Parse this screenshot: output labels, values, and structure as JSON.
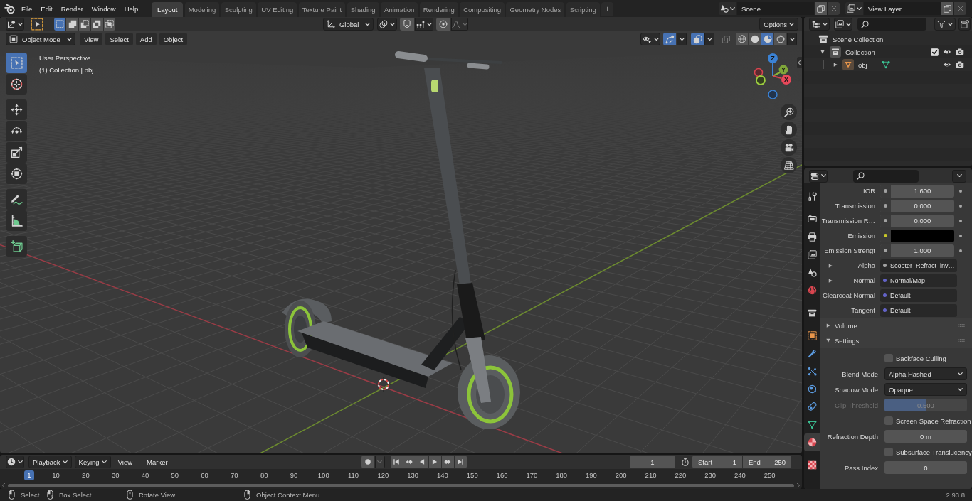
{
  "top_bar": {
    "menus": [
      "File",
      "Edit",
      "Render",
      "Window",
      "Help"
    ],
    "workspaces": [
      {
        "label": "Layout",
        "selected": true
      },
      {
        "label": "Modeling",
        "selected": false
      },
      {
        "label": "Sculpting",
        "selected": false
      },
      {
        "label": "UV Editing",
        "selected": false
      },
      {
        "label": "Texture Paint",
        "selected": false
      },
      {
        "label": "Shading",
        "selected": false
      },
      {
        "label": "Animation",
        "selected": false
      },
      {
        "label": "Rendering",
        "selected": false
      },
      {
        "label": "Compositing",
        "selected": false
      },
      {
        "label": "Geometry Nodes",
        "selected": false
      },
      {
        "label": "Scripting",
        "selected": false
      }
    ],
    "add_workspace": "+",
    "scene": "Scene",
    "view_layer": "View Layer"
  },
  "viewport": {
    "tool_settings": {
      "select_modes": [
        {
          "kind": "new",
          "selected": true
        },
        {
          "kind": "extend",
          "selected": false
        },
        {
          "kind": "subtract",
          "selected": false
        },
        {
          "kind": "invert",
          "selected": false
        },
        {
          "kind": "intersect",
          "selected": false
        }
      ],
      "transform_orientation": "Global",
      "snap_on": false,
      "proportional_on": false,
      "options": "Options"
    },
    "header": {
      "mode": "Object Mode",
      "menus": [
        "View",
        "Select",
        "Add",
        "Object"
      ],
      "gizmos_on": true,
      "overlays_on": true,
      "xray_on": false,
      "shading_modes": [
        {
          "kind": "wireframe",
          "selected": false
        },
        {
          "kind": "solid",
          "selected": false
        },
        {
          "kind": "material-preview",
          "selected": true
        },
        {
          "kind": "rendered",
          "selected": false
        }
      ]
    },
    "info": [
      "User Perspective",
      "(1) Collection | obj"
    ],
    "tool_groups": [
      [
        {
          "kind": "select-box",
          "selected": true
        },
        {
          "kind": "cursor",
          "selected": false
        }
      ],
      [
        {
          "kind": "move",
          "selected": false
        },
        {
          "kind": "rotate",
          "selected": false
        },
        {
          "kind": "scale",
          "selected": false
        },
        {
          "kind": "transform",
          "selected": false
        }
      ],
      [
        {
          "kind": "annotate",
          "selected": false
        },
        {
          "kind": "measure",
          "selected": false
        }
      ],
      [
        {
          "kind": "add-cube",
          "selected": false
        }
      ]
    ],
    "gizmo_axes": {
      "x": "X",
      "y": "Y",
      "z": "Z"
    }
  },
  "outliner": {
    "tree": [
      {
        "kind": "scene-collection",
        "label": "Scene Collection",
        "children": [
          {
            "kind": "collection",
            "label": "Collection",
            "expanded": true,
            "included": true,
            "visible": true,
            "renderable": true,
            "children": [
              {
                "kind": "mesh-object",
                "label": "obj",
                "expanded": false,
                "visible": true,
                "renderable": true
              }
            ]
          }
        ]
      }
    ]
  },
  "properties": {
    "tabs": [
      [
        {
          "kind": "tool",
          "selected": false
        }
      ],
      [
        {
          "kind": "render",
          "selected": false
        },
        {
          "kind": "output",
          "selected": false
        },
        {
          "kind": "view-layer",
          "selected": false
        },
        {
          "kind": "scene",
          "selected": false
        },
        {
          "kind": "world",
          "selected": false
        }
      ],
      [
        {
          "kind": "collection",
          "selected": false
        }
      ],
      [
        {
          "kind": "object",
          "selected": false
        },
        {
          "kind": "modifiers",
          "selected": false
        },
        {
          "kind": "particles",
          "selected": false
        },
        {
          "kind": "physics",
          "selected": false
        },
        {
          "kind": "constraints",
          "selected": false
        },
        {
          "kind": "data",
          "selected": false
        },
        {
          "kind": "material",
          "selected": true
        }
      ],
      [
        {
          "kind": "texture",
          "selected": false
        }
      ]
    ],
    "inputs": [
      {
        "kind": "number",
        "label": "IOR",
        "value": "1.600",
        "color": "#a1a1a1"
      },
      {
        "kind": "number",
        "label": "Transmission",
        "value": "0.000",
        "color": "#a1a1a1"
      },
      {
        "kind": "number",
        "label": "Transmission R…",
        "value": "0.000",
        "color": "#a1a1a1"
      },
      {
        "kind": "color",
        "label": "Emission",
        "swatch": {
          "color": "#000000"
        },
        "color": "#c7c729"
      },
      {
        "kind": "number",
        "label": "Emission Strengt",
        "value": "1.000",
        "color": "#a1a1a1"
      },
      {
        "kind": "link",
        "label": "Alpha",
        "value": "Scooter_Refract_inv…",
        "expanded": false,
        "color": "#a1a1a1"
      },
      {
        "kind": "link",
        "label": "Normal",
        "value": "Normal/Map",
        "expanded": false,
        "color": "#6363c7"
      },
      {
        "kind": "link",
        "label": "Clearcoat Normal",
        "value": "Default",
        "color": "#6363c7"
      },
      {
        "kind": "link",
        "label": "Tangent",
        "value": "Default",
        "color": "#6363c7"
      }
    ],
    "panels": [
      {
        "title": "Volume",
        "expanded": false
      },
      {
        "title": "Settings",
        "expanded": true,
        "rows": [
          {
            "kind": "checkbox",
            "label": "Backface Culling",
            "checked": false,
            "disabled": false
          },
          {
            "kind": "dropdown",
            "label": "Blend Mode",
            "value": "Alpha Hashed",
            "disabled": false
          },
          {
            "kind": "dropdown",
            "label": "Shadow Mode",
            "value": "Opaque",
            "disabled": false
          },
          {
            "kind": "slider",
            "label": "Clip Threshold",
            "value": "0.500",
            "level": 0.5,
            "disabled": true
          },
          {
            "kind": "checkbox",
            "label": "Screen Space Refraction",
            "checked": false,
            "disabled": false
          },
          {
            "kind": "number",
            "label": "Refraction Depth",
            "value": "0 m",
            "disabled": false
          },
          {
            "kind": "checkbox",
            "label": "Subsurface Translucency",
            "checked": false,
            "disabled": false
          },
          {
            "kind": "number",
            "label": "Pass Index",
            "value": "0",
            "disabled": false
          }
        ]
      }
    ]
  },
  "timeline": {
    "menus": [
      {
        "kind": "dropdown",
        "label": "Playback"
      },
      {
        "kind": "dropdown",
        "label": "Keying"
      },
      {
        "kind": "menu",
        "label": "View"
      },
      {
        "kind": "menu",
        "label": "Marker"
      }
    ],
    "auto_keying_on": false,
    "controls": [
      {
        "kind": "jump-start"
      },
      {
        "kind": "prev-key"
      },
      {
        "kind": "play-reverse"
      },
      {
        "kind": "play"
      },
      {
        "kind": "next-key"
      },
      {
        "kind": "jump-end"
      }
    ],
    "current_frame": "1",
    "preview_range_on": false,
    "start_label": "Start",
    "start": "1",
    "end_label": "End",
    "end": "250",
    "ruler": [
      {
        "label": "1",
        "selected": true
      },
      {
        "label": "10",
        "selected": false
      },
      {
        "label": "20",
        "selected": false
      },
      {
        "label": "30",
        "selected": false
      },
      {
        "label": "40",
        "selected": false
      },
      {
        "label": "50",
        "selected": false
      },
      {
        "label": "60",
        "selected": false
      },
      {
        "label": "70",
        "selected": false
      },
      {
        "label": "80",
        "selected": false
      },
      {
        "label": "90",
        "selected": false
      },
      {
        "label": "100",
        "selected": false
      },
      {
        "label": "110",
        "selected": false
      },
      {
        "label": "120",
        "selected": false
      },
      {
        "label": "130",
        "selected": false
      },
      {
        "label": "140",
        "selected": false
      },
      {
        "label": "150",
        "selected": false
      },
      {
        "label": "160",
        "selected": false
      },
      {
        "label": "170",
        "selected": false
      },
      {
        "label": "180",
        "selected": false
      },
      {
        "label": "190",
        "selected": false
      },
      {
        "label": "200",
        "selected": false
      },
      {
        "label": "210",
        "selected": false
      },
      {
        "label": "220",
        "selected": false
      },
      {
        "label": "230",
        "selected": false
      },
      {
        "label": "240",
        "selected": false
      },
      {
        "label": "250",
        "selected": false
      }
    ]
  },
  "status_bar": {
    "hints": [
      {
        "kind": "left-click",
        "label": "Select"
      },
      {
        "kind": "left-drag",
        "label": "Box Select"
      },
      {
        "kind": "middle-click",
        "label": "Rotate View"
      },
      {
        "kind": "right-click",
        "label": "Object Context Menu"
      }
    ],
    "version": "2.93.8"
  }
}
